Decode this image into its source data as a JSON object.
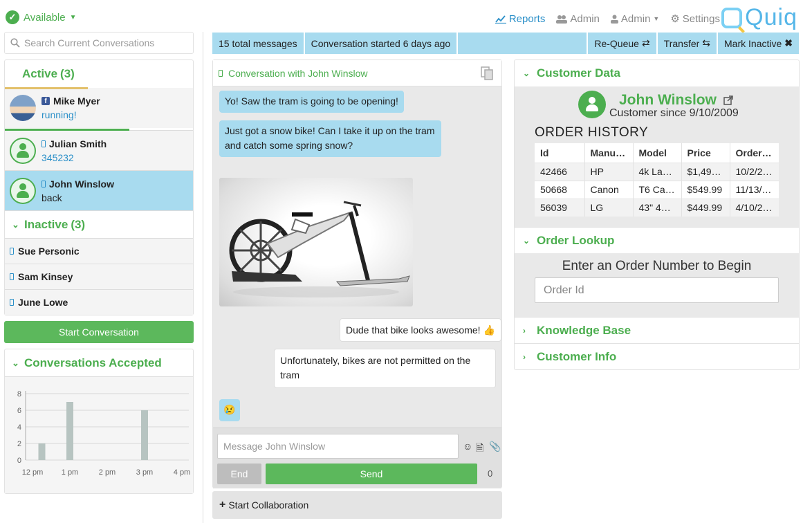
{
  "status": {
    "label": "Available"
  },
  "topnav": {
    "reports": "Reports",
    "admin1": "Admin",
    "admin2": "Admin",
    "settings": "Settings",
    "logo": "Quiq"
  },
  "search": {
    "placeholder": "Search Current Conversations"
  },
  "active": {
    "title": "Active",
    "count": "(3)",
    "items": [
      {
        "name": "Mike Myer",
        "sub": "running!",
        "channel": "facebook",
        "progress": 0.44,
        "progress_color": "#e3c06a"
      },
      {
        "name": "Julian Smith",
        "sub": "345232",
        "channel": "sms",
        "progress": 0.66,
        "progress_color": "#4cae4f"
      },
      {
        "name": "John Winslow",
        "sub": "back",
        "channel": "sms",
        "selected": true
      }
    ]
  },
  "inactive": {
    "title": "Inactive",
    "count": "(3)",
    "items": [
      {
        "name": "Sue Personic"
      },
      {
        "name": "Sam Kinsey"
      },
      {
        "name": "June Lowe"
      }
    ]
  },
  "start_conversation": "Start Conversation",
  "chart_data": {
    "type": "bar",
    "title": "Conversations Accepted",
    "xlabel": "",
    "ylabel": "",
    "x_ticks": [
      "12 pm",
      "1 pm",
      "2 pm",
      "3 pm",
      "4 pm"
    ],
    "y_ticks": [
      "0",
      "2",
      "4",
      "6",
      "8"
    ],
    "ylim": [
      0,
      8
    ],
    "x_range": [
      0,
      4
    ],
    "bars": [
      {
        "x": 0.25,
        "value": 2
      },
      {
        "x": 1.0,
        "value": 7
      },
      {
        "x": 3.0,
        "value": 6
      }
    ],
    "grid": true,
    "bar_color": "#b7c4c1"
  },
  "infobar": {
    "total": "15 total messages",
    "started": "Conversation started 6 days ago",
    "requeue": "Re-Queue",
    "transfer": "Transfer",
    "mark_inactive": "Mark Inactive"
  },
  "chat": {
    "header": "Conversation with John Winslow",
    "messages": [
      "Yo! Saw the tram is going to be opening!",
      "Just got a snow bike! Can I take it up on the tram and catch some spring snow?",
      "Dude that bike looks awesome! 👍",
      "Unfortunately, bikes are not permitted on the tram",
      "😢"
    ],
    "input_placeholder": "Message John Winslow",
    "end": "End",
    "send": "Send",
    "char_count": "0",
    "collab": "Start Collaboration"
  },
  "customer": {
    "panel_title": "Customer Data",
    "name": "John Winslow",
    "since": "Customer since 9/10/2009",
    "order_history": "ORDER HISTORY",
    "columns": [
      "Id",
      "Manuf…",
      "Model",
      "Price",
      "OrderD…"
    ],
    "rows": [
      [
        "42466",
        "HP",
        "4k Lap…",
        "$1,499…",
        "10/2/2…"
      ],
      [
        "50668",
        "Canon",
        "T6 Ca…",
        "$549.99",
        "11/13/…"
      ],
      [
        "56039",
        "LG",
        "43\" 4k …",
        "$449.99",
        "4/10/2…"
      ]
    ]
  },
  "lookup": {
    "title": "Order Lookup",
    "label": "Enter an Order Number to Begin",
    "placeholder": "Order Id"
  },
  "knowledge": {
    "title": "Knowledge Base"
  },
  "info": {
    "title": "Customer Info"
  }
}
